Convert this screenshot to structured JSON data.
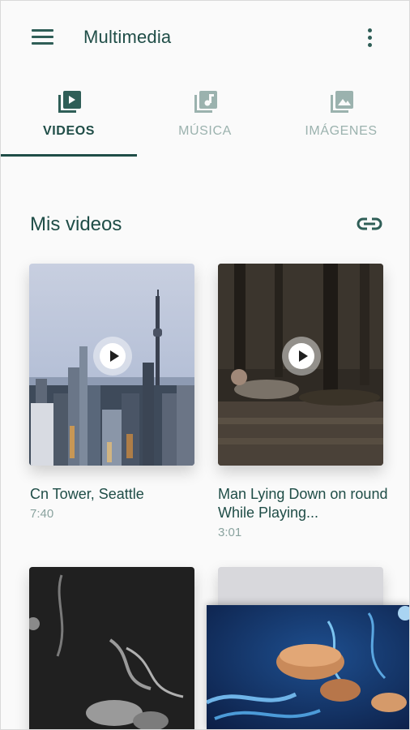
{
  "appbar": {
    "title": "Multimedia",
    "menu_icon": "menu-icon",
    "more_icon": "more-vert-icon"
  },
  "tabs": [
    {
      "label": "VIDEOS",
      "icon": "video-library-icon",
      "active": true
    },
    {
      "label": "MÚSICA",
      "icon": "music-library-icon",
      "active": false
    },
    {
      "label": "IMÁGENES",
      "icon": "image-library-icon",
      "active": false
    }
  ],
  "section": {
    "title": "Mis videos",
    "link_icon": "link-icon"
  },
  "videos": [
    {
      "title": "Cn Tower, Seattle",
      "duration": "7:40"
    },
    {
      "title": "Man Lying Down on round While Playing...",
      "duration": "3:01"
    }
  ],
  "colors": {
    "primary": "#1f4d47",
    "inactive": "#9bb2ae",
    "surface": "#fafafa"
  }
}
